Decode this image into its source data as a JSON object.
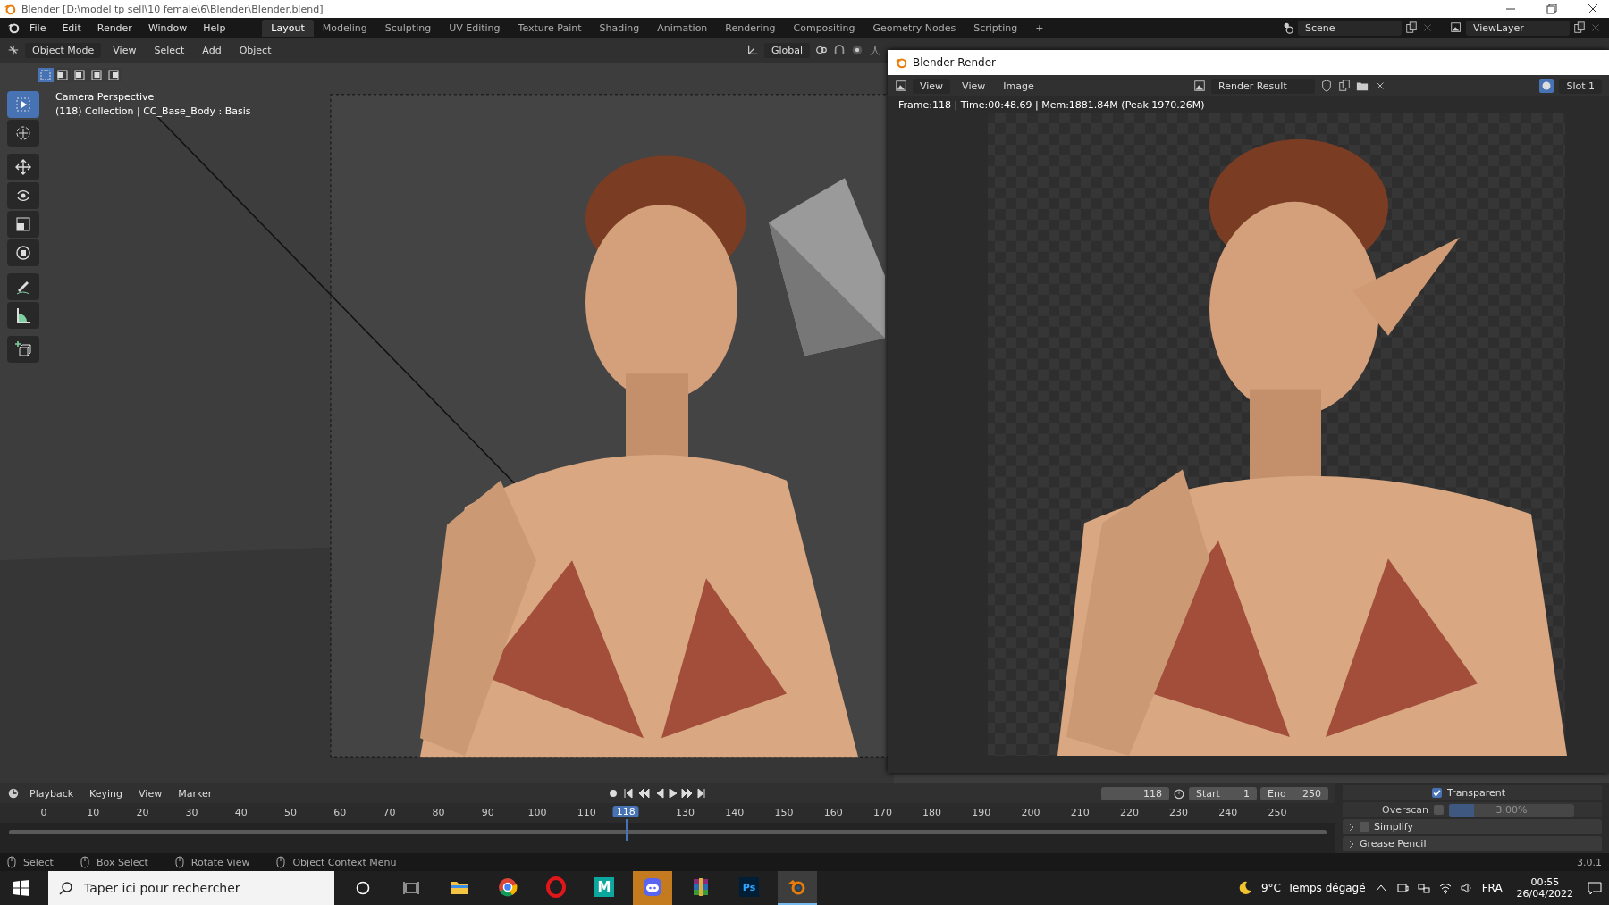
{
  "window": {
    "title": "Blender [D:\\model tp sell\\10 female\\6\\Blender\\Blender.blend]"
  },
  "menu": [
    "File",
    "Edit",
    "Render",
    "Window",
    "Help"
  ],
  "workspaces": [
    {
      "label": "Layout",
      "selected": true
    },
    {
      "label": "Modeling",
      "selected": false
    },
    {
      "label": "Sculpting",
      "selected": false
    },
    {
      "label": "UV Editing",
      "selected": false
    },
    {
      "label": "Texture Paint",
      "selected": false
    },
    {
      "label": "Shading",
      "selected": false
    },
    {
      "label": "Animation",
      "selected": false
    },
    {
      "label": "Rendering",
      "selected": false
    },
    {
      "label": "Compositing",
      "selected": false
    },
    {
      "label": "Geometry Nodes",
      "selected": false
    },
    {
      "label": "Scripting",
      "selected": false
    }
  ],
  "add_workspace": "+",
  "scene": "Scene",
  "view_layer": "ViewLayer",
  "viewport_header": {
    "mode": "Object Mode",
    "menus": [
      "View",
      "Select",
      "Add",
      "Object"
    ],
    "orientation": "Global"
  },
  "select_modes": [
    {
      "selected": true
    },
    {
      "selected": false
    },
    {
      "selected": false
    },
    {
      "selected": false
    },
    {
      "selected": false
    }
  ],
  "tools": [
    {
      "kind": "select",
      "selected": true
    },
    {
      "kind": "cursor",
      "selected": false
    },
    {
      "kind": "move",
      "selected": false
    },
    {
      "kind": "rotate",
      "selected": false
    },
    {
      "kind": "scale",
      "selected": false
    },
    {
      "kind": "transform",
      "selected": false
    },
    {
      "kind": "annotate",
      "selected": false
    },
    {
      "kind": "measure",
      "selected": false
    },
    {
      "kind": "add_cube",
      "selected": false
    }
  ],
  "viewport": {
    "lines": [
      "Camera Perspective",
      "(118) Collection | CC_Base_Body : Basis"
    ]
  },
  "render_window": {
    "title": "Blender Render",
    "view_dropdown": "View",
    "menus": [
      "View",
      "Image"
    ],
    "image_name": "Render Result",
    "slot": "Slot 1",
    "info": "Frame:118 | Time:00:48.69 | Mem:1881.84M (Peak 1970.26M)"
  },
  "timeline": {
    "menus": [
      "Playback",
      "Keying",
      "View",
      "Marker"
    ],
    "current_frame": "118",
    "start_label": "Start",
    "start": "1",
    "end_label": "End",
    "end": "250",
    "ticks": [
      "0",
      "10",
      "20",
      "30",
      "40",
      "50",
      "60",
      "70",
      "80",
      "90",
      "100",
      "110",
      "130",
      "140",
      "150",
      "160",
      "170",
      "180",
      "190",
      "200",
      "210",
      "220",
      "230",
      "240",
      "250"
    ],
    "playhead": {
      "label": "118",
      "level": 0.472
    }
  },
  "properties": {
    "transparent": {
      "label": "Transparent",
      "checked": true
    },
    "overscan": {
      "label": "Overscan",
      "checked": false,
      "value": "3.00%",
      "level": 0.2
    },
    "panels": [
      {
        "label": "Simplify",
        "checked": false
      },
      {
        "label": "Grease Pencil"
      }
    ]
  },
  "status_bar": {
    "hints": [
      "Select",
      "Box Select",
      "Rotate View",
      "Object Context Menu"
    ],
    "version": "3.0.1"
  },
  "taskbar": {
    "search_placeholder": "Taper ici pour rechercher",
    "apps": [
      {
        "kind": "explorer",
        "selected": false,
        "flash": false
      },
      {
        "kind": "chrome",
        "selected": false,
        "flash": false
      },
      {
        "kind": "opera",
        "selected": false,
        "flash": false
      },
      {
        "kind": "modeler",
        "label": "M",
        "selected": false,
        "flash": false
      },
      {
        "kind": "discord",
        "selected": false,
        "flash": true
      },
      {
        "kind": "archiver",
        "selected": false,
        "flash": false
      },
      {
        "kind": "photoshop",
        "label": "Ps",
        "selected": false,
        "flash": false
      },
      {
        "kind": "blender",
        "selected": true,
        "flash": false
      }
    ],
    "weather": "9°C  Temps dégagé",
    "language": "FRA",
    "time": "00:55",
    "date": "26/04/2022"
  }
}
